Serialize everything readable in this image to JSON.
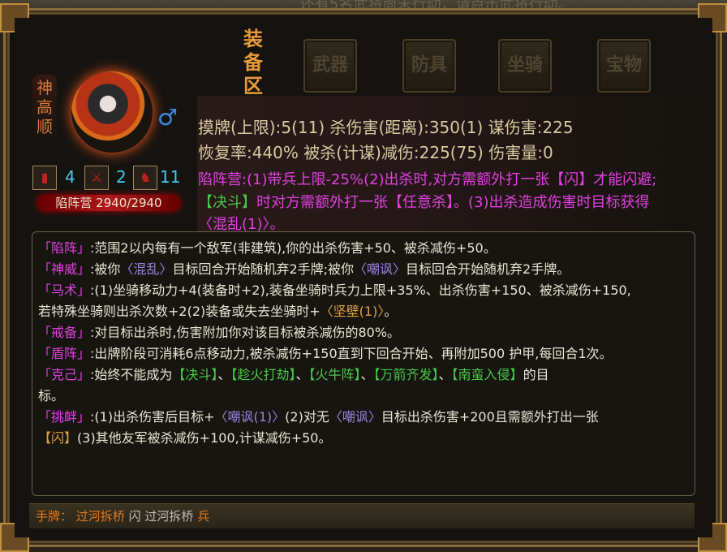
{
  "background_text": "还有5名武将尚未行动，请点击武将行动。",
  "hero": {
    "name": "神高顺",
    "gender_icon": "male-icon",
    "stat_cards": [
      {
        "icon": "card-icon",
        "value": "4"
      },
      {
        "icon": "sword-icon",
        "value": "2"
      },
      {
        "icon": "horse-icon",
        "value": "11"
      }
    ],
    "troop_label": "陷阵营 2940/2940",
    "hp_fraction": 1.0
  },
  "equipment": {
    "title": "装备区",
    "slots": [
      "武器",
      "防具",
      "坐骑",
      "宝物"
    ]
  },
  "stats": {
    "line1": "摸牌(上限):5(11)    杀伤害(距离):350(1)    谋伤害:225",
    "line2": "恢复率:440%    被杀(计谋)减伤:225(75)    伤害量:0"
  },
  "troop_desc": {
    "l1": "陷阵营:(1)带兵上限-25%(2)出杀时,对方需额外打一张【闪】才能闪避;",
    "l2a": "【决斗】",
    "l2b": "时对方需额外打一张【任意杀】。(3)出杀造成伤害时目标获得",
    "l3": "〈混乱(1)〉。"
  },
  "skills": {
    "s1_name": "「陷阵」",
    "s1_text": ":范围2以内每有一个敌军(非建筑),你的出杀伤害+50、被杀减伤+50。",
    "s2_name": "「神威」",
    "s2_t1": ":被你",
    "s2_k1": "〈混乱〉",
    "s2_t2": "目标回合开始随机弃2手牌;被你",
    "s2_k2": "〈嘲讽〉",
    "s2_t3": "目标回合开始随机弃2手牌。",
    "s3_name": "「马术」",
    "s3_text": ":(1)坐骑移动力+4(装备时+2),装备坐骑时兵力上限+35%、出杀伤害+150、被杀减伤+150,",
    "s3_text2": "若特殊坐骑则出杀次数+2(2)装备或失去坐骑时+",
    "s3_k": "〈坚壁(1)〉",
    "s3_end": "。",
    "s4_name": "「戒备」",
    "s4_text": ":对目标出杀时,伤害附加你对该目标被杀减伤的80%。",
    "s5_name": "「盾阵」",
    "s5_text": ":出牌阶段可消耗6点移动力,被杀减伤+150直到下回合开始、再附加500 护甲,每回合1次。",
    "s6_name": "「克己」",
    "s6_t1": ":始终不能成为",
    "s6_g": [
      "【决斗】",
      "【趁火打劫】",
      "【火牛阵】",
      "【万箭齐发】",
      "【南蛮入侵】"
    ],
    "s6_sep": "、",
    "s6_t2": "的目",
    "s6_t3": "标。",
    "s7_name": "「挑衅」",
    "s7_t1": ":(1)出杀伤害后目标+",
    "s7_k1": "〈嘲讽(1)〉",
    "s7_t2": "(2)对无",
    "s7_k2": "〈嘲讽〉",
    "s7_t3": "目标出杀伤害+200且需额外打出一张",
    "s7_l2k": "【闪】",
    "s7_l2": "(3)其他友军被杀减伤+100,计谋减伤+50。"
  },
  "hand": {
    "label": "手牌：",
    "cards": [
      "过河拆桥",
      "闪",
      "过河拆桥",
      "兵"
    ]
  }
}
